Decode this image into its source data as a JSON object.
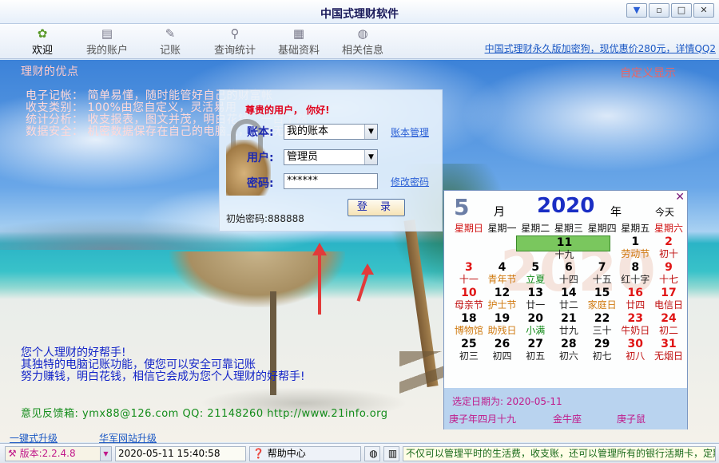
{
  "window": {
    "title": "中国式理财软件",
    "buttons": [
      "▼",
      "▫",
      "□",
      "✕"
    ]
  },
  "toolbar": {
    "items": [
      {
        "label": "欢迎",
        "icon": "welcome-icon",
        "active": true
      },
      {
        "label": "我的账户",
        "icon": "account-icon",
        "active": false
      },
      {
        "label": "记账",
        "icon": "pen-icon",
        "active": false
      },
      {
        "label": "查询统计",
        "icon": "search-icon",
        "active": false
      },
      {
        "label": "基础资料",
        "icon": "document-icon",
        "active": false
      },
      {
        "label": "相关信息",
        "icon": "globe-icon",
        "active": false
      }
    ],
    "promo": "中国式理财永久版加密狗，现优惠价280元，详情QQ2"
  },
  "advantages": {
    "title": "理财的优点",
    "lines": [
      "电子记帐：  简单易懂，随时能管好自己的财富帐",
      "收支类别：  100%由您自定义，灵活易用",
      "统计分析：  收支报表，图文并茂，明白花钱，一目了然",
      "数据安全：  机密数据保存在自己的电脑上，安全无忧"
    ],
    "custom_display": "自定义显示"
  },
  "login": {
    "greeting": "尊贵的用户， 你好!",
    "account_label": "账本:",
    "account_value": "我的账本",
    "user_label": "用户:",
    "user_value": "管理员",
    "password_label": "密码:",
    "password_value": "******",
    "account_link": "账本管理",
    "password_link": "修改密码",
    "login_button": "登 录",
    "initial_password": "初始密码:888888"
  },
  "slogan": {
    "lines": [
      "您个人理财的好帮手!",
      "其独特的电脑记账功能，使您可以安全可靠记账",
      "努力赚钱，明白花钱，相信它会成为您个人理财的好帮手!"
    ]
  },
  "feedback": "意见反馈箱: ymx88@126.com QQ: 21148260  http://www.21info.org",
  "calendar": {
    "month": "5",
    "month_char": "月",
    "year": "2020",
    "year_char": "年",
    "today_label": "今天",
    "watermark": "2020",
    "weekdays": [
      "星期日",
      "星期一",
      "星期二",
      "星期三",
      "星期四",
      "星期五",
      "星期六"
    ],
    "days": [
      {
        "n": "",
        "l": ""
      },
      {
        "n": "",
        "l": ""
      },
      {
        "n": "",
        "l": ""
      },
      {
        "n": "",
        "l": ""
      },
      {
        "n": "",
        "l": ""
      },
      {
        "n": "1",
        "l": "劳动节",
        "cls": "hol"
      },
      {
        "n": "2",
        "l": "初十",
        "cls": "we"
      },
      {
        "n": "3",
        "l": "十一",
        "cls": "we"
      },
      {
        "n": "4",
        "l": "青年节",
        "cls": "hol"
      },
      {
        "n": "5",
        "l": "立夏",
        "cls": "term"
      },
      {
        "n": "6",
        "l": "十四"
      },
      {
        "n": "7",
        "l": "十五"
      },
      {
        "n": "8",
        "l": "红十字"
      },
      {
        "n": "9",
        "l": "十七",
        "cls": "we"
      },
      {
        "n": "10",
        "l": "母亲节",
        "cls": "we"
      },
      {
        "n": "11",
        "l": "十九",
        "cls": "sel"
      },
      {
        "n": "12",
        "l": "护士节",
        "cls": "hol"
      },
      {
        "n": "13",
        "l": "廿一"
      },
      {
        "n": "14",
        "l": "廿二"
      },
      {
        "n": "15",
        "l": "家庭日",
        "cls": "hol"
      },
      {
        "n": "16",
        "l": "廿四",
        "cls": "we"
      },
      {
        "n": "17",
        "l": "电信日",
        "cls": "we"
      },
      {
        "n": "18",
        "l": "博物馆",
        "cls": "hol"
      },
      {
        "n": "19",
        "l": "助残日",
        "cls": "hol"
      },
      {
        "n": "20",
        "l": "小满",
        "cls": "term"
      },
      {
        "n": "21",
        "l": "廿九"
      },
      {
        "n": "22",
        "l": "三十"
      },
      {
        "n": "23",
        "l": "牛奶日",
        "cls": "we"
      },
      {
        "n": "24",
        "l": "初二",
        "cls": "we"
      },
      {
        "n": "25",
        "l": "初三"
      },
      {
        "n": "26",
        "l": "初四"
      },
      {
        "n": "27",
        "l": "初五"
      },
      {
        "n": "28",
        "l": "初六"
      },
      {
        "n": "29",
        "l": "初七"
      },
      {
        "n": "30",
        "l": "初八",
        "cls": "we"
      },
      {
        "n": "31",
        "l": "无烟日",
        "cls": "we"
      }
    ],
    "selected_date": "选定日期为: 2020-05-11",
    "lunar": "庚子年四月十九",
    "constellation": "金牛座",
    "zodiac": "庚子鼠"
  },
  "links": {
    "upgrade_one_click": "一键式升级",
    "upgrade_site": "华军网站升级"
  },
  "status": {
    "version": "版本:2.2.4.8",
    "datetime": "2020-05-11 15:40:58",
    "help": "帮助中心",
    "message": "不仅可以管理平时的生活费，收支账，还可以管理所有的银行活期卡，定期"
  }
}
